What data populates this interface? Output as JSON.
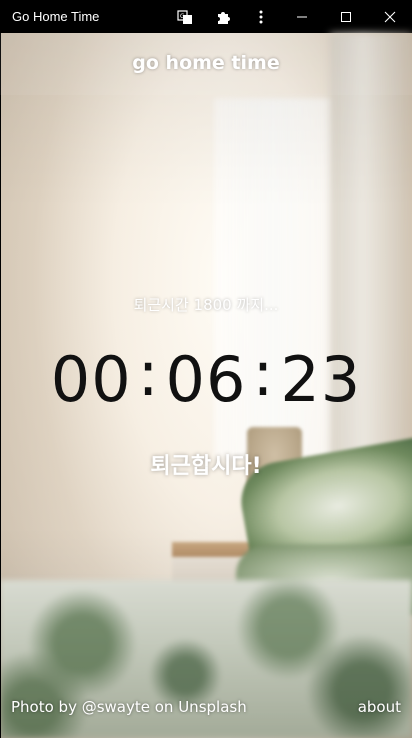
{
  "window": {
    "title": "Go Home Time",
    "icons": {
      "translate": "translate-icon",
      "extensions": "puzzle-icon",
      "menu": "more-vertical-icon",
      "minimize": "minimize-icon",
      "maximize": "maximize-icon",
      "close": "close-icon"
    }
  },
  "app": {
    "title": "go home time",
    "until_text": "퇴근시간 1800 까지...",
    "timer": {
      "hours": "00",
      "minutes": "06",
      "seconds": "23",
      "separator": ":"
    },
    "message": "퇴근합시다!"
  },
  "footer": {
    "credit": "Photo by @swayte on Unsplash",
    "about": "about"
  },
  "colors": {
    "titlebar": "#000000",
    "text_light": "#ffffff",
    "timer_text": "#111111"
  }
}
